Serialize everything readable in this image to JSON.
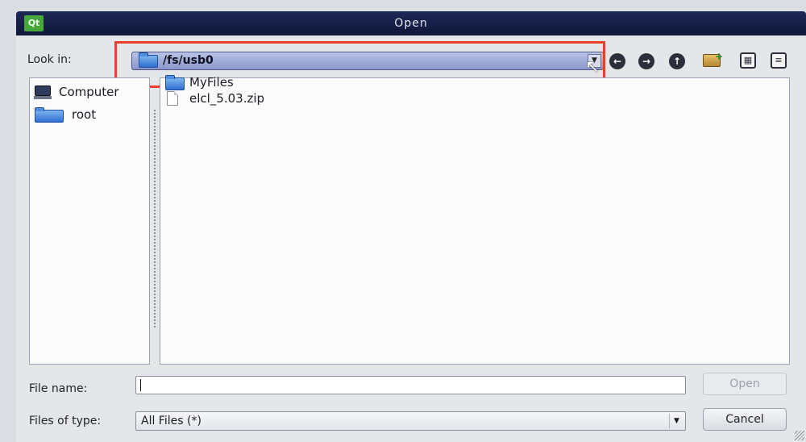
{
  "window": {
    "title": "Open",
    "logo": "Qt"
  },
  "look_in": {
    "label": "Look in:",
    "path": "/fs/usb0"
  },
  "toolbar": {
    "back_icon": "back-arrow-icon",
    "forward_icon": "forward-arrow-icon",
    "up_icon": "parent-directory-icon",
    "new_folder_icon": "new-folder-icon",
    "detail_view_icon": "detail-view-icon",
    "list_view_icon": "list-view-icon"
  },
  "sidebar": {
    "items": [
      {
        "label": "Computer",
        "icon": "computer-icon"
      },
      {
        "label": "root",
        "icon": "folder-icon"
      }
    ]
  },
  "files": [
    {
      "name": "MyFiles",
      "icon": "folder-icon"
    },
    {
      "name": "elcl_5.03.zip",
      "icon": "file-icon"
    }
  ],
  "file_name": {
    "label": "File name:",
    "value": ""
  },
  "files_of_type": {
    "label": "Files of type:",
    "value": "All Files (*)"
  },
  "buttons": {
    "open": "Open",
    "cancel": "Cancel"
  },
  "colors": {
    "highlight": "#e8402b",
    "title_bar": "#10173a",
    "combo": "#8a97cc"
  }
}
